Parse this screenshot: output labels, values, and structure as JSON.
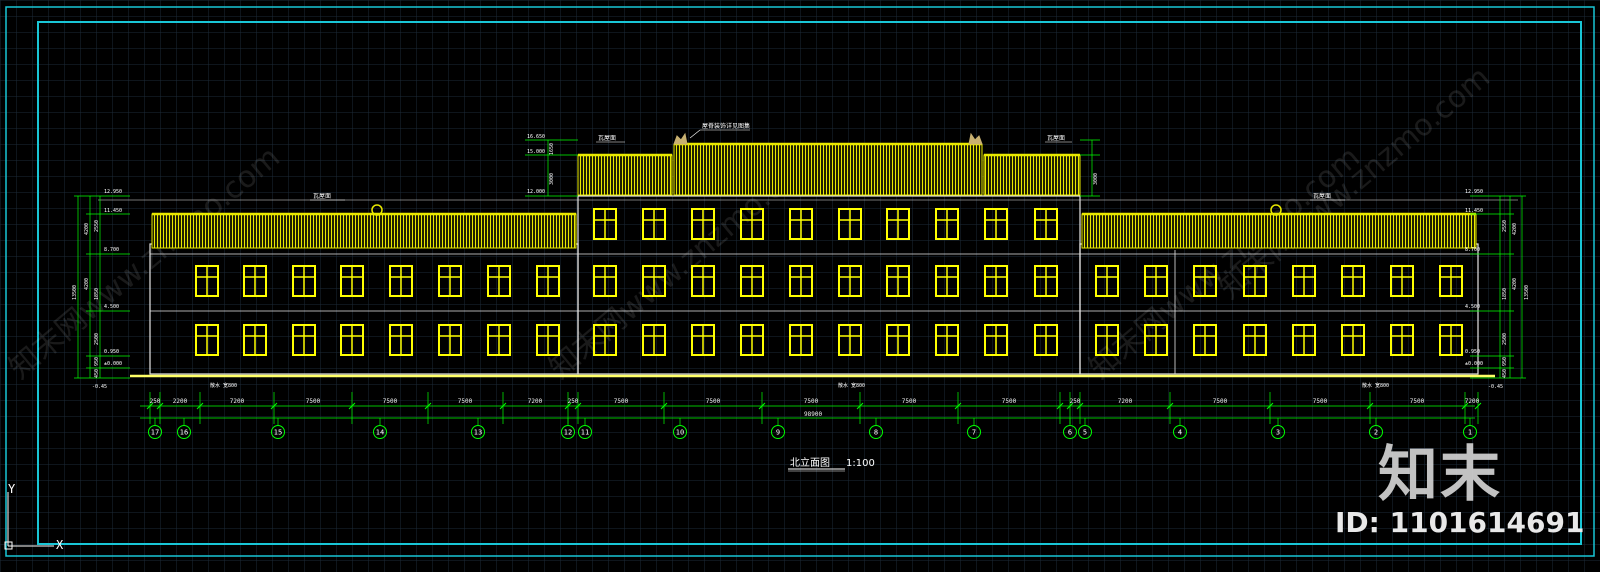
{
  "drawing": {
    "title": "北立面图",
    "scale": "1:100",
    "colors": {
      "background": "#000000",
      "grid": "#1c2a38",
      "frame": "#19c6d6",
      "building_outline": "#e6e6e6",
      "roof_tiles": "#e8e800",
      "windows": "#ffff00",
      "dimensions": "#00ff00",
      "text": "#ffffff",
      "axis_circles": "#00ff00"
    },
    "axis_labels": [
      "17",
      "16",
      "15",
      "14",
      "13",
      "12",
      "11",
      "10",
      "9",
      "8",
      "7",
      "6",
      "5",
      "4",
      "3",
      "2",
      "1"
    ],
    "bay_dimensions_left": [
      "250",
      "2200",
      "7200",
      "7500",
      "7500",
      "7500",
      "7200",
      "250"
    ],
    "bay_dimensions_center": [
      "7500",
      "7500",
      "7500",
      "7500",
      "7500"
    ],
    "bay_dimensions_right": [
      "250",
      "7200",
      "7500",
      "7500",
      "7500",
      "7200",
      "250"
    ],
    "overall_dimension": "98900",
    "levels_left": [
      "12.950",
      "11.450",
      "8.700",
      "4.500",
      "0.950",
      "±0.000",
      "-0.45"
    ],
    "levels_right": [
      "12.950",
      "11.450",
      "8.700",
      "4.500",
      "0.950",
      "±0.000",
      "-0.45"
    ],
    "levels_tower": [
      "16.650",
      "15.000",
      "12.000"
    ],
    "story_dims_left": [
      "4200",
      "4200",
      "13500",
      "2550",
      "1850",
      "2500",
      "950",
      "450"
    ],
    "story_dims_right": [
      "4200",
      "4200",
      "13500",
      "2550",
      "1850",
      "2500",
      "950",
      "450"
    ],
    "tower_dims": [
      "1650",
      "3000",
      "3000"
    ],
    "roof_notes": {
      "left": "瓦屋面",
      "right": "瓦屋面",
      "tower_left": "瓦屋面",
      "tower_right": "瓦屋面",
      "ridge": "屋脊装饰详见图集"
    },
    "ground_notes": [
      "散水 宽800",
      "散水 宽800",
      "散水 宽800"
    ]
  },
  "watermarks": [
    "知末网www.znzmo.com",
    "知末网www.znzmo.com",
    "知末网www.znzmo.com",
    "知末网www.znzmo.com"
  ],
  "brand": {
    "logo_text": "知末",
    "id_text": "ID: 1101614691"
  },
  "ucs": {
    "x_label": "X",
    "y_label": "Y"
  }
}
